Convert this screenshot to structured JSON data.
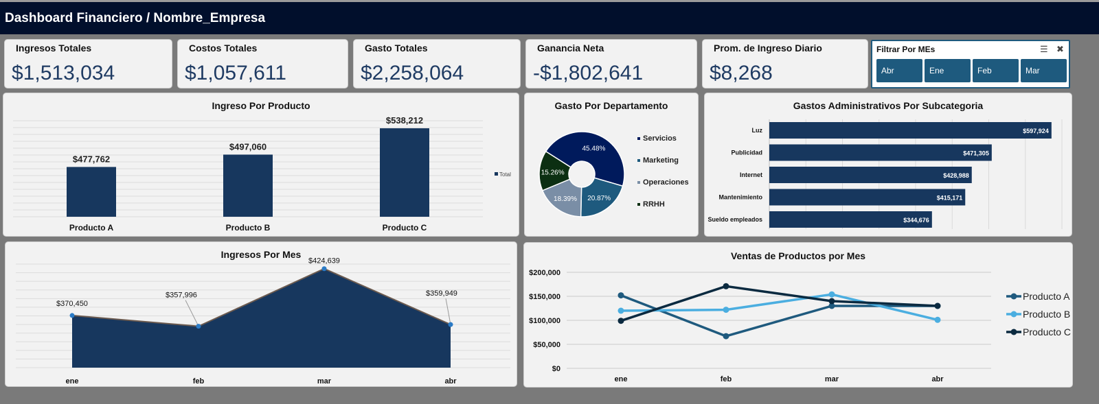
{
  "header": {
    "title": "Dashboard Financiero / Nombre_Empresa"
  },
  "kpis": [
    {
      "label": "Ingresos Totales",
      "value": "$1,513,034"
    },
    {
      "label": "Costos Totales",
      "value": "$1,057,611"
    },
    {
      "label": "Gasto Totales",
      "value": "$2,258,064"
    },
    {
      "label": "Ganancia Neta",
      "value": "-$1,802,641"
    },
    {
      "label": "Prom. de Ingreso Diario",
      "value": "$8,268"
    }
  ],
  "filter": {
    "title": "Filtrar Por MEs",
    "multiselect_icon": "multiselect-icon",
    "clear_icon": "clear-filter-icon",
    "options": [
      "Abr",
      "Ene",
      "Feb",
      "Mar"
    ]
  },
  "colors": {
    "navy": "#17375e",
    "dark": "#010f2c",
    "teal": "#1f5a7e",
    "light_blue": "#4baee0",
    "green": "#0c2f12",
    "grey": "#7a8ea6"
  },
  "chart_data": [
    {
      "id": "ingreso_por_producto",
      "type": "bar",
      "title": "Ingreso Por Producto",
      "categories": [
        "Producto A",
        "Producto B",
        "Producto C"
      ],
      "values": [
        477762,
        497060,
        538212
      ],
      "data_labels": [
        "$477,762",
        "$497,060",
        "$538,212"
      ],
      "series": [
        {
          "name": "Total",
          "values": [
            477762,
            497060,
            538212
          ]
        }
      ],
      "ylim": [
        400000,
        550000
      ],
      "grid": true,
      "legend": "right"
    },
    {
      "id": "gasto_por_departamento",
      "type": "pie",
      "title": "Gasto Por Departamento",
      "categories": [
        "Servicios",
        "Marketing",
        "Operaciones",
        "RRHH"
      ],
      "values": [
        45.48,
        20.87,
        18.39,
        15.26
      ],
      "data_labels": [
        "45.48%",
        "20.87%",
        "18.39%",
        "15.26%"
      ],
      "legend": "right"
    },
    {
      "id": "gastos_admin_subcategoria",
      "type": "bar",
      "orientation": "horizontal",
      "title": "Gastos Administrativos Por Subcategoria",
      "categories": [
        "Luz",
        "Publicidad",
        "Internet",
        "Mantenimiento",
        "Sueldo empleados"
      ],
      "values": [
        597924,
        471305,
        428988,
        415171,
        344676
      ],
      "data_labels": [
        "$597,924",
        "$471,305",
        "$428,988",
        "$415,171",
        "$344,676"
      ],
      "xlim": [
        0,
        620000
      ],
      "grid": true
    },
    {
      "id": "ingresos_por_mes",
      "type": "area",
      "title": "Ingresos Por Mes",
      "categories": [
        "ene",
        "feb",
        "mar",
        "abr"
      ],
      "values": [
        370450,
        357996,
        424639,
        359949
      ],
      "data_labels": [
        "$370,450",
        "$357,996",
        "$424,639",
        "$359,949"
      ],
      "ylim": [
        310000,
        430000
      ],
      "grid": true
    },
    {
      "id": "ventas_productos_por_mes",
      "type": "line",
      "title": "Ventas de Productos por Mes",
      "categories": [
        "ene",
        "feb",
        "mar",
        "abr"
      ],
      "series": [
        {
          "name": "Producto A",
          "values": [
            152000,
            67000,
            130000,
            130000
          ]
        },
        {
          "name": "Producto B",
          "values": [
            120000,
            122000,
            154000,
            101000
          ]
        },
        {
          "name": "Producto C",
          "values": [
            99000,
            171000,
            140000,
            130000
          ]
        }
      ],
      "yticks": [
        "$0",
        "$50,000",
        "$100,000",
        "$150,000",
        "$200,000"
      ],
      "ylim": [
        0,
        200000
      ],
      "grid": true,
      "legend": "right"
    }
  ]
}
